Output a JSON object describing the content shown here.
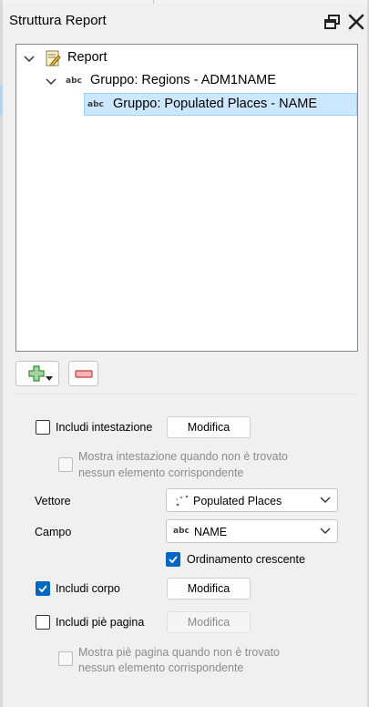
{
  "panel": {
    "title": "Struttura Report"
  },
  "tree": {
    "items": [
      {
        "label": "Report",
        "icon": "report-icon"
      },
      {
        "label": "Gruppo: Regions - ADM1NAME",
        "icon": "abc"
      },
      {
        "label": "Gruppo: Populated Places - NAME",
        "icon": "abc",
        "selected": true
      }
    ],
    "abc_glyph": "abc"
  },
  "toolbar": {
    "add_icon": "add-section-icon",
    "remove_icon": "remove-section-icon"
  },
  "options": {
    "include_header": {
      "label": "Includi intestazione",
      "checked": false
    },
    "header_edit": "Modifica",
    "show_header_label_line1": "Mostra intestazione quando non è trovato",
    "show_header_label_line2": "nessun elemento corrispondente",
    "layer_label": "Vettore",
    "layer_value": "Populated Places",
    "field_label": "Campo",
    "field_value": "NAME",
    "field_prefix": "abc",
    "sort_ascending": {
      "label": "Ordinamento crescente",
      "checked": true
    },
    "include_body": {
      "label": "Includi corpo",
      "checked": true
    },
    "body_edit": "Modifica",
    "include_footer": {
      "label": "Includi piè pagina",
      "checked": false
    },
    "footer_edit": "Modifica",
    "show_footer_label_line1": "Mostra piè pagina quando non è trovato",
    "show_footer_label_line2": "nessun elemento corrispondente"
  },
  "colors": {
    "selection": "#cce8ff",
    "check_accent": "#0067c0"
  }
}
